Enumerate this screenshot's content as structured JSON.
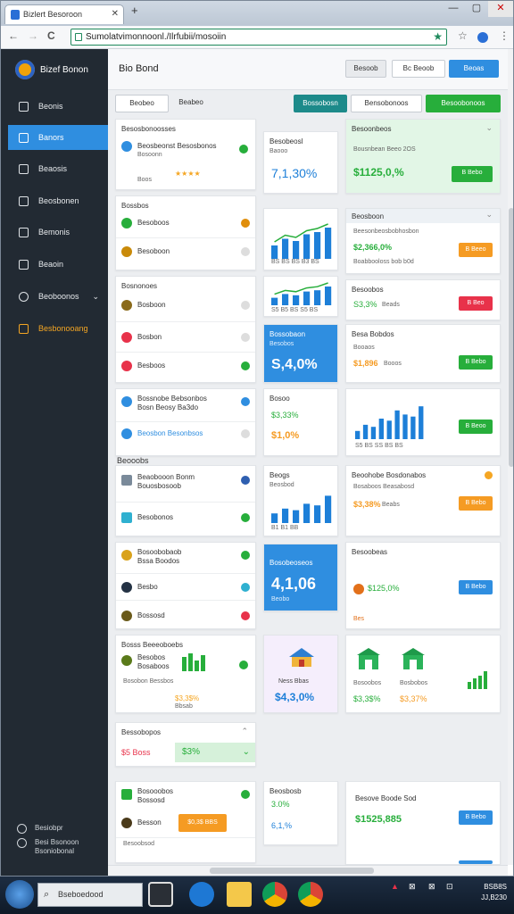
{
  "browser": {
    "tab_title": "Bizlert Besoroon",
    "new_tab": "+",
    "url": "Sumolatvimonnoonl./Ilrfubii/mosoiin",
    "controls": [
      "—",
      "▢",
      "✕"
    ],
    "nav": [
      "←",
      "→",
      "C"
    ]
  },
  "sidebar": {
    "brand": "Bizef Bonon",
    "items": [
      {
        "label": "Beonis"
      },
      {
        "label": "Banors"
      },
      {
        "label": "Beaosis"
      },
      {
        "label": "Beosbonen"
      },
      {
        "label": "Bemonis"
      },
      {
        "label": "Beaoin"
      },
      {
        "label": "Beoboonos"
      },
      {
        "label": "Besbonooang"
      }
    ],
    "footer": [
      {
        "line1": "Besiobpr",
        "line2": ""
      },
      {
        "line1": "Besi Bsonoon",
        "line2": "Bsoniobonal"
      }
    ]
  },
  "header": {
    "title": "Bio Bond",
    "btn1": "Besoob",
    "btn2": "Bc Beoob",
    "btn3": "Beoas"
  },
  "toolbar": {
    "tab1": "Beobeo",
    "tab2": "Beabeo",
    "btn_teal": "Bossobosn",
    "btn_select": "Bensobonoos",
    "btn_green": "Besoobonoos"
  },
  "cards": {
    "c1": {
      "title": "Besosbonoosses",
      "r1": "Beosbeonst",
      "r1b": "Besosbonos",
      "r1c": "Bosoonn",
      "rating": "★★★★",
      "r2": "Boos"
    },
    "c2": {
      "title": "Besobeosl",
      "sub": "Baooo",
      "value": "7,1,30%"
    },
    "c3": {
      "title": "Besoonbeos",
      "sub": "Bousnbean Beeo 2OS",
      "value": "$1125,0,%",
      "pill": "B Bebo"
    },
    "c4": {
      "title": "Bossbos",
      "r1": "Besoboos",
      "r2": "Besoboon"
    },
    "c5": {
      "axis": "BS BS BS B3 BS"
    },
    "c6": {
      "title": "Beosboon",
      "sub": "Beesonbeosbobhosbon",
      "value": "$2,366,0%",
      "sub2": "Boabbooloss bob b0d",
      "pill": "B Beeo"
    },
    "c7": {
      "title": "Bosnonoes",
      "r1": "Bosboon",
      "r2": "Bosbon",
      "r3": "Besboos"
    },
    "c8": {
      "axis": "S5 B5 BS S5 BS"
    },
    "c9": {
      "title": "Besoobos",
      "value": "S3,3%",
      "sub": "Beads",
      "pill": "B Beo"
    },
    "c10": {
      "title": "Bossobaon",
      "sub": "Besobos",
      "value": "S,4,0%"
    },
    "c11": {
      "title": "Besa Bobdos",
      "sub": "Booaos",
      "value": "$1,896",
      "sub2": "Booos",
      "pill": "B Bebo"
    },
    "c12": {
      "r1": "Bossnobe Bebsonbos",
      "r1b": "Bosn Beosy Ba3do",
      "r2": "Beosbon Besonbsos"
    },
    "c13": {
      "title": "Bosoo",
      "value": "$3,33%",
      "value2": "$1,0%"
    },
    "c14": {
      "axis": "S5 BS SS BS BS",
      "pill": "B Beoo"
    },
    "section": "Beooobs",
    "c15": {
      "r1": "Beaobooon Bonm",
      "r1b": "Bouosbosoob",
      "r2": "Besobonos"
    },
    "c16": {
      "title": "Beogs",
      "sub": "Beosbod",
      "axis": "B1 B1 BB"
    },
    "c17": {
      "title": "Beoohobe Bosdonabos",
      "sub": "Bosaboos Beasabosd",
      "value": "$3,38%",
      "sub2": "Beabs",
      "pill": "B Bebo"
    },
    "c18": {
      "r1": "Bosoobobaob",
      "r1b": "Bssa Boodos",
      "r2": "Besbo",
      "r3": "Bossosd"
    },
    "c19": {
      "title": "Bosobeoseos",
      "value": "4,1,06",
      "sub": "Beobo"
    },
    "c20": {
      "title": "Besoobeas",
      "value": "$125,0%",
      "sub": "Bes",
      "pill": "B Bebo"
    },
    "c21": {
      "title": "Bosss Beeeoboebs",
      "r1": "Besobos",
      "r1b": "Bosaboos",
      "r2": "Bosobon Bessbos",
      "rating": "$3,3$%",
      "rating2": "Bbsab"
    },
    "c22": {
      "title": "Ness Bbas",
      "value": "$4,3,0%"
    },
    "c23": {
      "s1": "Bosoobos",
      "s2": "Bosbobos",
      "v1": "$3,3$%",
      "v2": "$3,37%"
    },
    "c24": {
      "title": "Bessobopos",
      "left": "$5 Boss",
      "value": "$3%"
    },
    "c25": {
      "r1": "Bosooobos",
      "r1b": "Bossosd",
      "r2": "Besson",
      "pill": "$0,3$ BBS",
      "r3": "Besoobsod"
    },
    "c26": {
      "title": "Beosbosb",
      "value": "3.0%",
      "value2": "6,1,%"
    },
    "c27": {
      "title": "Besove Boode Sod",
      "value": "$1525,885",
      "pill": "B Bebo"
    }
  },
  "taskbar": {
    "search": "Bseboedood",
    "clock1": "BSB8S",
    "clock2": "JJ,B230"
  },
  "colors": {
    "accent": "#2f8ee0",
    "green": "#27ae3b",
    "orange": "#f5a623",
    "red": "#e8324a",
    "teal": "#1d8a8a",
    "sidebar": "#222a33"
  }
}
